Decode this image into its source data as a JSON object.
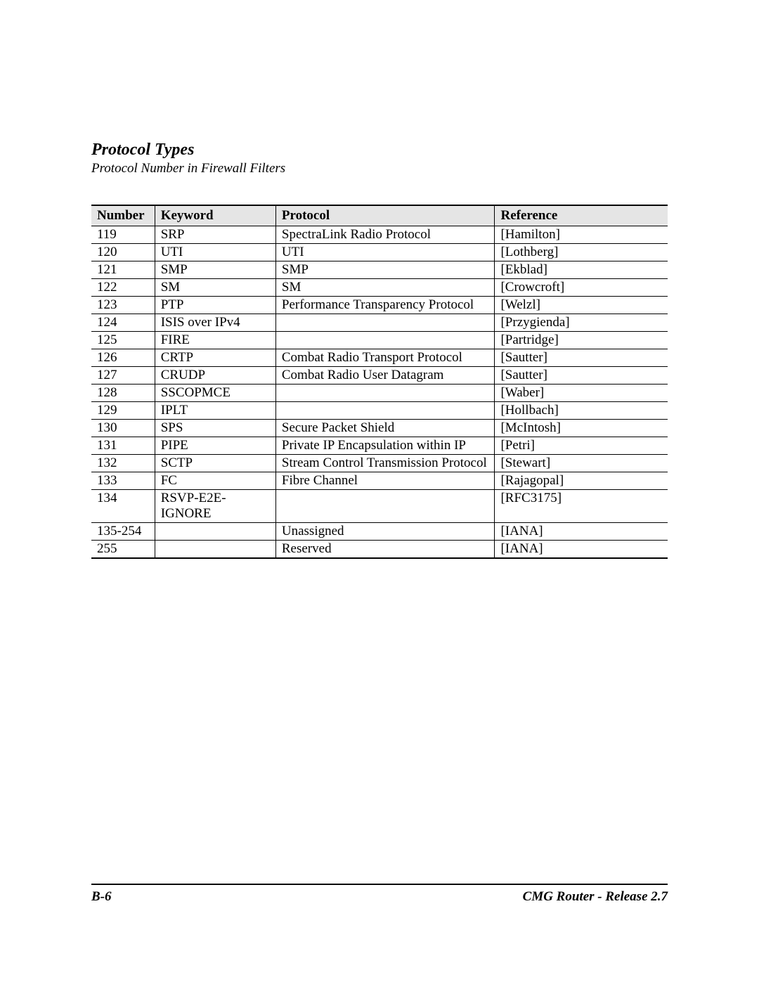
{
  "header": {
    "title": "Protocol Types",
    "subtitle": "Protocol Number in Firewall Filters"
  },
  "table": {
    "columns": {
      "number": "Number",
      "keyword": "Keyword",
      "protocol": "Protocol",
      "reference": "Reference"
    },
    "rows": [
      {
        "number": "119",
        "keyword": "SRP",
        "protocol": "SpectraLink Radio Protocol",
        "reference": "[Hamilton]"
      },
      {
        "number": "120",
        "keyword": "UTI",
        "protocol": "UTI",
        "reference": "[Lothberg]"
      },
      {
        "number": "121",
        "keyword": "SMP",
        "protocol": "SMP",
        "reference": "[Ekblad]"
      },
      {
        "number": "122",
        "keyword": "SM",
        "protocol": "SM",
        "reference": "[Crowcroft]"
      },
      {
        "number": "123",
        "keyword": "PTP",
        "protocol": "Performance Transparency Protocol",
        "reference": "[Welzl]"
      },
      {
        "number": "124",
        "keyword": "ISIS over IPv4",
        "protocol": "",
        "reference": "[Przygienda]"
      },
      {
        "number": "125",
        "keyword": "FIRE",
        "protocol": "",
        "reference": "[Partridge]"
      },
      {
        "number": "126",
        "keyword": "CRTP",
        "protocol": "Combat Radio Transport Protocol",
        "reference": "[Sautter]"
      },
      {
        "number": "127",
        "keyword": "CRUDP",
        "protocol": "Combat Radio User Datagram",
        "reference": "[Sautter]"
      },
      {
        "number": "128",
        "keyword": "SSCOPMCE",
        "protocol": "",
        "reference": "[Waber]"
      },
      {
        "number": "129",
        "keyword": "IPLT",
        "protocol": "",
        "reference": "[Hollbach]"
      },
      {
        "number": "130",
        "keyword": "SPS",
        "protocol": "Secure Packet Shield",
        "reference": "[McIntosh]"
      },
      {
        "number": "131",
        "keyword": "PIPE",
        "protocol": "Private IP Encapsulation within IP",
        "reference": "[Petri]"
      },
      {
        "number": "132",
        "keyword": "SCTP",
        "protocol": "Stream Control Transmission Protocol",
        "reference": "[Stewart]"
      },
      {
        "number": "133",
        "keyword": "FC",
        "protocol": "Fibre Channel",
        "reference": "[Rajagopal]"
      },
      {
        "number": "134",
        "keyword": "RSVP-E2E-IGNORE",
        "protocol": "",
        "reference": "[RFC3175]"
      },
      {
        "number": "135-254",
        "keyword": "",
        "protocol": "Unassigned",
        "reference": "[IANA]"
      },
      {
        "number": "255",
        "keyword": "",
        "protocol": "Reserved",
        "reference": "[IANA]"
      }
    ]
  },
  "footer": {
    "page_label": "B-6",
    "doc_label": "CMG Router - Release 2.7"
  }
}
